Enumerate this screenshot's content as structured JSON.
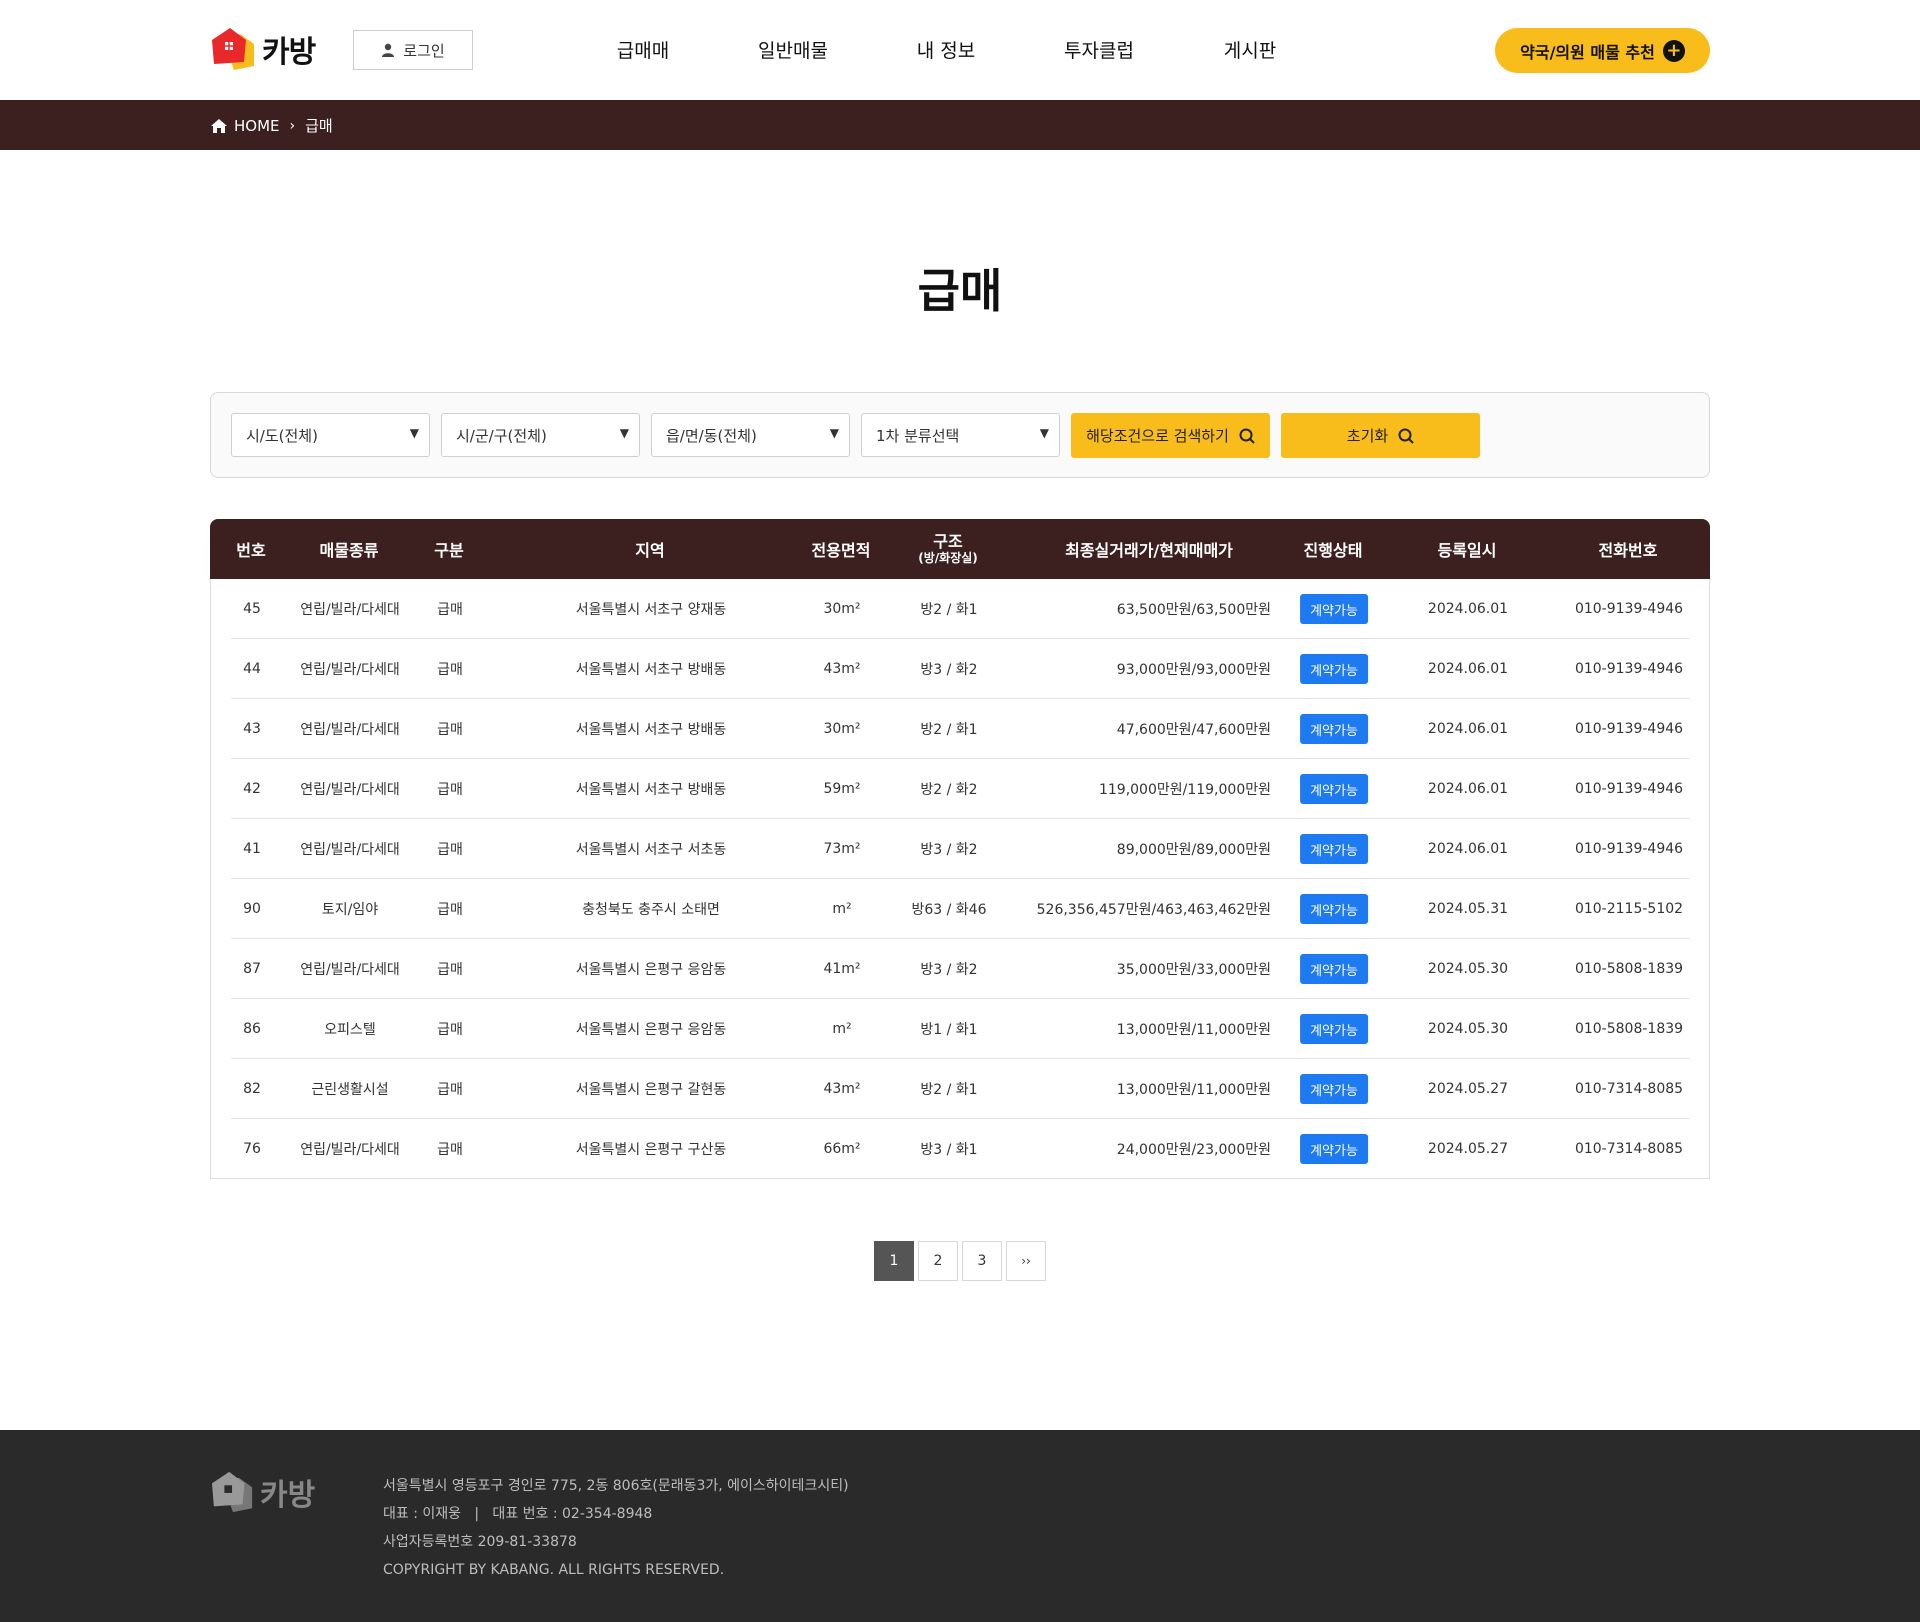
{
  "header": {
    "logo_text": "카방",
    "login_label": "로그인",
    "nav": [
      "급매매",
      "일반매물",
      "내 정보",
      "투자클럽",
      "게시판"
    ],
    "recommend_label": "약국/의원 매물 추천"
  },
  "breadcrumb": {
    "home": "HOME",
    "current": "급매"
  },
  "page_title": "급매",
  "filter": {
    "selects": [
      "시/도(전체)",
      "시/군/구(전체)",
      "읍/면/동(전체)",
      "1차 분류선택"
    ],
    "search_label": "해당조건으로 검색하기",
    "reset_label": "초기화"
  },
  "table": {
    "headers": {
      "no": "번호",
      "type": "매물종류",
      "category": "구분",
      "region": "지역",
      "area": "전용면적",
      "structure": "구조",
      "structure_sub": "(방/화장실)",
      "price": "최종실거래가/현재매매가",
      "status": "진행상태",
      "date": "등록일시",
      "phone": "전화번호"
    },
    "rows": [
      {
        "no": "45",
        "type": "연립/빌라/다세대",
        "category": "급매",
        "region": "서울특별시 서초구 양재동",
        "area": "30m²",
        "structure": "방2 / 화1",
        "price": "63,500만원/63,500만원",
        "status": "계약가능",
        "date": "2024.06.01",
        "phone": "010-9139-4946"
      },
      {
        "no": "44",
        "type": "연립/빌라/다세대",
        "category": "급매",
        "region": "서울특별시 서초구 방배동",
        "area": "43m²",
        "structure": "방3 / 화2",
        "price": "93,000만원/93,000만원",
        "status": "계약가능",
        "date": "2024.06.01",
        "phone": "010-9139-4946"
      },
      {
        "no": "43",
        "type": "연립/빌라/다세대",
        "category": "급매",
        "region": "서울특별시 서초구 방배동",
        "area": "30m²",
        "structure": "방2 / 화1",
        "price": "47,600만원/47,600만원",
        "status": "계약가능",
        "date": "2024.06.01",
        "phone": "010-9139-4946"
      },
      {
        "no": "42",
        "type": "연립/빌라/다세대",
        "category": "급매",
        "region": "서울특별시 서초구 방배동",
        "area": "59m²",
        "structure": "방2 / 화2",
        "price": "119,000만원/119,000만원",
        "status": "계약가능",
        "date": "2024.06.01",
        "phone": "010-9139-4946"
      },
      {
        "no": "41",
        "type": "연립/빌라/다세대",
        "category": "급매",
        "region": "서울특별시 서초구 서초동",
        "area": "73m²",
        "structure": "방3 / 화2",
        "price": "89,000만원/89,000만원",
        "status": "계약가능",
        "date": "2024.06.01",
        "phone": "010-9139-4946"
      },
      {
        "no": "90",
        "type": "토지/임야",
        "category": "급매",
        "region": "충청북도 충주시 소태면",
        "area": "m²",
        "structure": "방63 / 화46",
        "price": "526,356,457만원/463,463,462만원",
        "status": "계약가능",
        "date": "2024.05.31",
        "phone": "010-2115-5102"
      },
      {
        "no": "87",
        "type": "연립/빌라/다세대",
        "category": "급매",
        "region": "서울특별시 은평구 응암동",
        "area": "41m²",
        "structure": "방3 / 화2",
        "price": "35,000만원/33,000만원",
        "status": "계약가능",
        "date": "2024.05.30",
        "phone": "010-5808-1839"
      },
      {
        "no": "86",
        "type": "오피스텔",
        "category": "급매",
        "region": "서울특별시 은평구 응암동",
        "area": "m²",
        "structure": "방1 / 화1",
        "price": "13,000만원/11,000만원",
        "status": "계약가능",
        "date": "2024.05.30",
        "phone": "010-5808-1839"
      },
      {
        "no": "82",
        "type": "근린생활시설",
        "category": "급매",
        "region": "서울특별시 은평구 갈현동",
        "area": "43m²",
        "structure": "방2 / 화1",
        "price": "13,000만원/11,000만원",
        "status": "계약가능",
        "date": "2024.05.27",
        "phone": "010-7314-8085"
      },
      {
        "no": "76",
        "type": "연립/빌라/다세대",
        "category": "급매",
        "region": "서울특별시 은평구 구산동",
        "area": "66m²",
        "structure": "방3 / 화1",
        "price": "24,000만원/23,000만원",
        "status": "계약가능",
        "date": "2024.05.27",
        "phone": "010-7314-8085"
      }
    ]
  },
  "pagination": {
    "pages": [
      "1",
      "2",
      "3"
    ],
    "current": "1",
    "next_label": "››"
  },
  "footer": {
    "logo_text": "카방",
    "address": "서울특별시 영등포구 경인로 775, 2동 806호(문래동3가, 에이스하이테크시티)",
    "ceo_line": "대표 : 이재웅   |   대표 번호 : 02-354-8948",
    "biz_no": "사업자등록번호 209-81-33878",
    "copyright": "COPYRIGHT BY KABANG. ALL RIGHTS RESERVED."
  },
  "colors": {
    "accent": "#f9bd1b",
    "dark_brown": "#3c1f1f",
    "status_blue": "#1e7af0",
    "footer_bg": "#2a2a2a"
  }
}
